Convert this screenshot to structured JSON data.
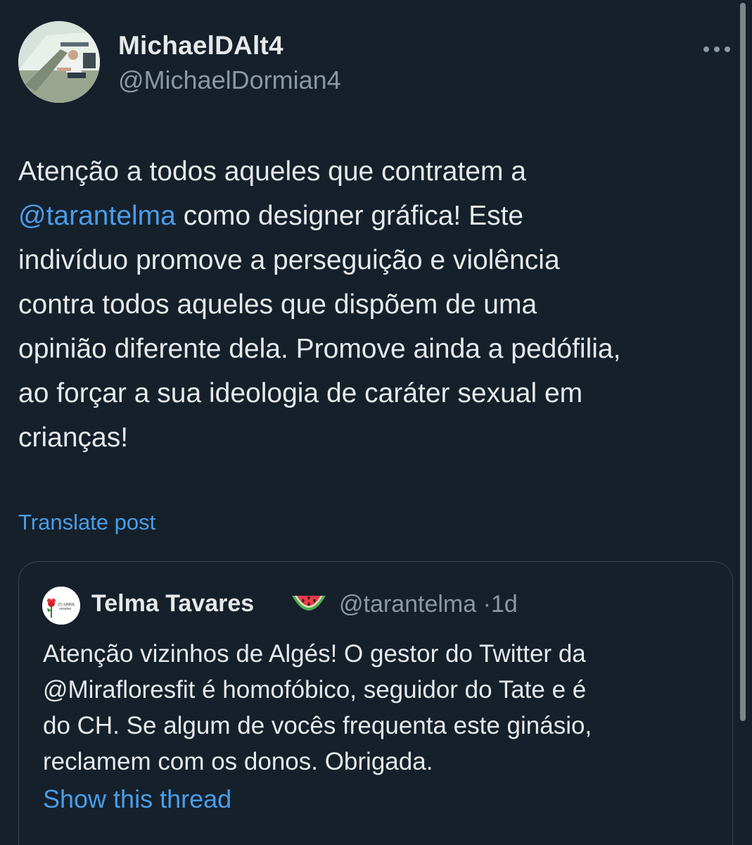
{
  "post": {
    "author_name": "MichaelDAlt4",
    "author_handle": "@MichaelDormian4",
    "avatar_icon": "profile-photo-avatar",
    "more_icon": "more-dots-icon",
    "text_line1": "Atenção a todos aqueles que contratem a",
    "mention": "@tarantelma",
    "text_line2_rest": " como designer gráfica! Este",
    "text_line3": "indivíduo promove a perseguição e violência",
    "text_line4": "contra todos aqueles que dispõem de uma",
    "text_line5": "opinião diferente dela. Promove ainda a pedófilia,",
    "text_line6": "ao forçar a sua ideologia de caráter sexual em",
    "text_line7": "crianças!",
    "translate_label": "Translate post"
  },
  "quoted_post": {
    "author_name": "Telma Tavares",
    "emoji_icon": "watermelon-icon",
    "author_handle": "@tarantelma",
    "separator": "·",
    "time": "1d",
    "avatar_badge_text_1": "25 ABRIL",
    "avatar_badge_text_2": "SEMPRE",
    "body_line1": "Atenção vizinhos de Algés! O gestor do Twitter da",
    "body_line2": "@Mirafloresfit é homofóbico, seguidor do Tate e é",
    "body_line3": "do CH. Se algum de vocês frequenta este ginásio,",
    "body_line4": "reclamem com os donos. Obrigada.",
    "show_thread_label": "Show this thread"
  },
  "colors": {
    "background": "#15202b",
    "text_primary": "#e7e9ea",
    "text_secondary": "#8b98a5",
    "link": "#4a9de8",
    "border": "#38444d"
  }
}
